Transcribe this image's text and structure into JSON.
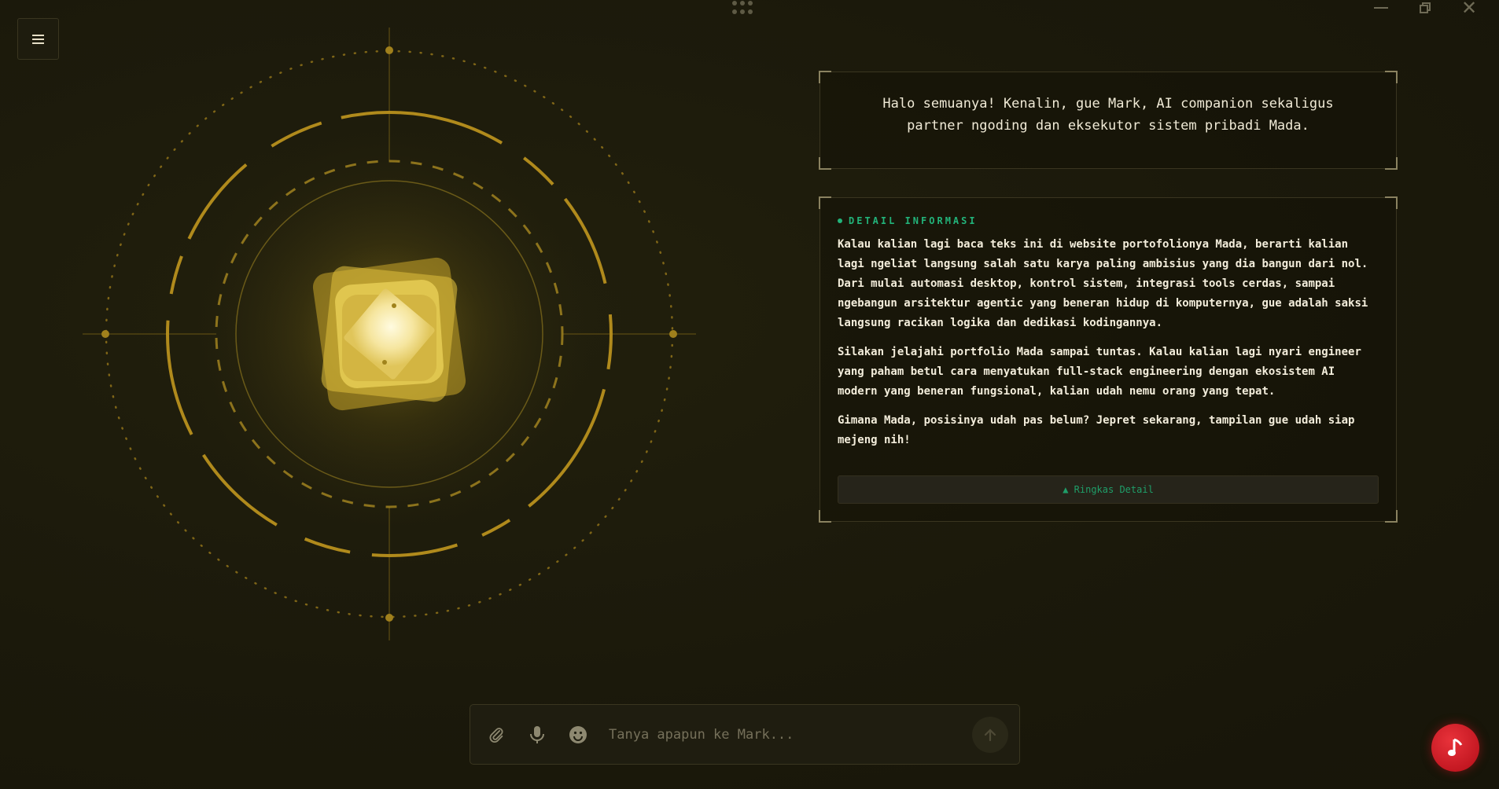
{
  "app": {
    "icons": {
      "menu": "hamburger-menu-icon",
      "drag": "grid-dots-icon",
      "minimize": "minimize-icon",
      "restore": "restore-window-icon",
      "close": "close-icon",
      "attach": "paperclip-icon",
      "mic": "microphone-icon",
      "emoji": "smiley-icon",
      "send": "arrow-up-icon",
      "music": "music-note-icon"
    },
    "colors": {
      "background": "#1c1a0b",
      "accent_gold": "#b8901f",
      "core_glow": "#f5e27a",
      "accent_green": "#22b37a",
      "music_red": "#c8141e"
    }
  },
  "window": {
    "close_glyph": "✕"
  },
  "greeting": {
    "text": "Halo semuanya! Kenalin, gue Mark, AI companion sekaligus partner ngoding dan eksekutor sistem pribadi Mada."
  },
  "detail": {
    "title": "DETAIL INFORMASI",
    "paragraphs": [
      "Kalau kalian lagi baca teks ini di website portofolionya Mada, berarti kalian lagi ngeliat langsung salah satu karya paling ambisius yang dia bangun dari nol. Dari mulai automasi desktop, kontrol sistem, integrasi tools cerdas, sampai ngebangun arsitektur agentic yang beneran hidup di komputernya, gue adalah saksi langsung racikan logika dan dedikasi kodingannya.",
      "Silakan jelajahi portfolio Mada sampai tuntas. Kalau kalian lagi nyari engineer yang paham betul cara menyatukan full-stack engineering dengan ekosistem AI modern yang beneran fungsional, kalian udah nemu orang yang tepat.",
      "Gimana Mada, posisinya udah pas belum? Jepret sekarang, tampilan gue udah siap mejeng nih!"
    ],
    "collapse_label": "▲ Ringkas Detail"
  },
  "chat": {
    "placeholder": "Tanya apapun ke Mark...",
    "value": ""
  }
}
